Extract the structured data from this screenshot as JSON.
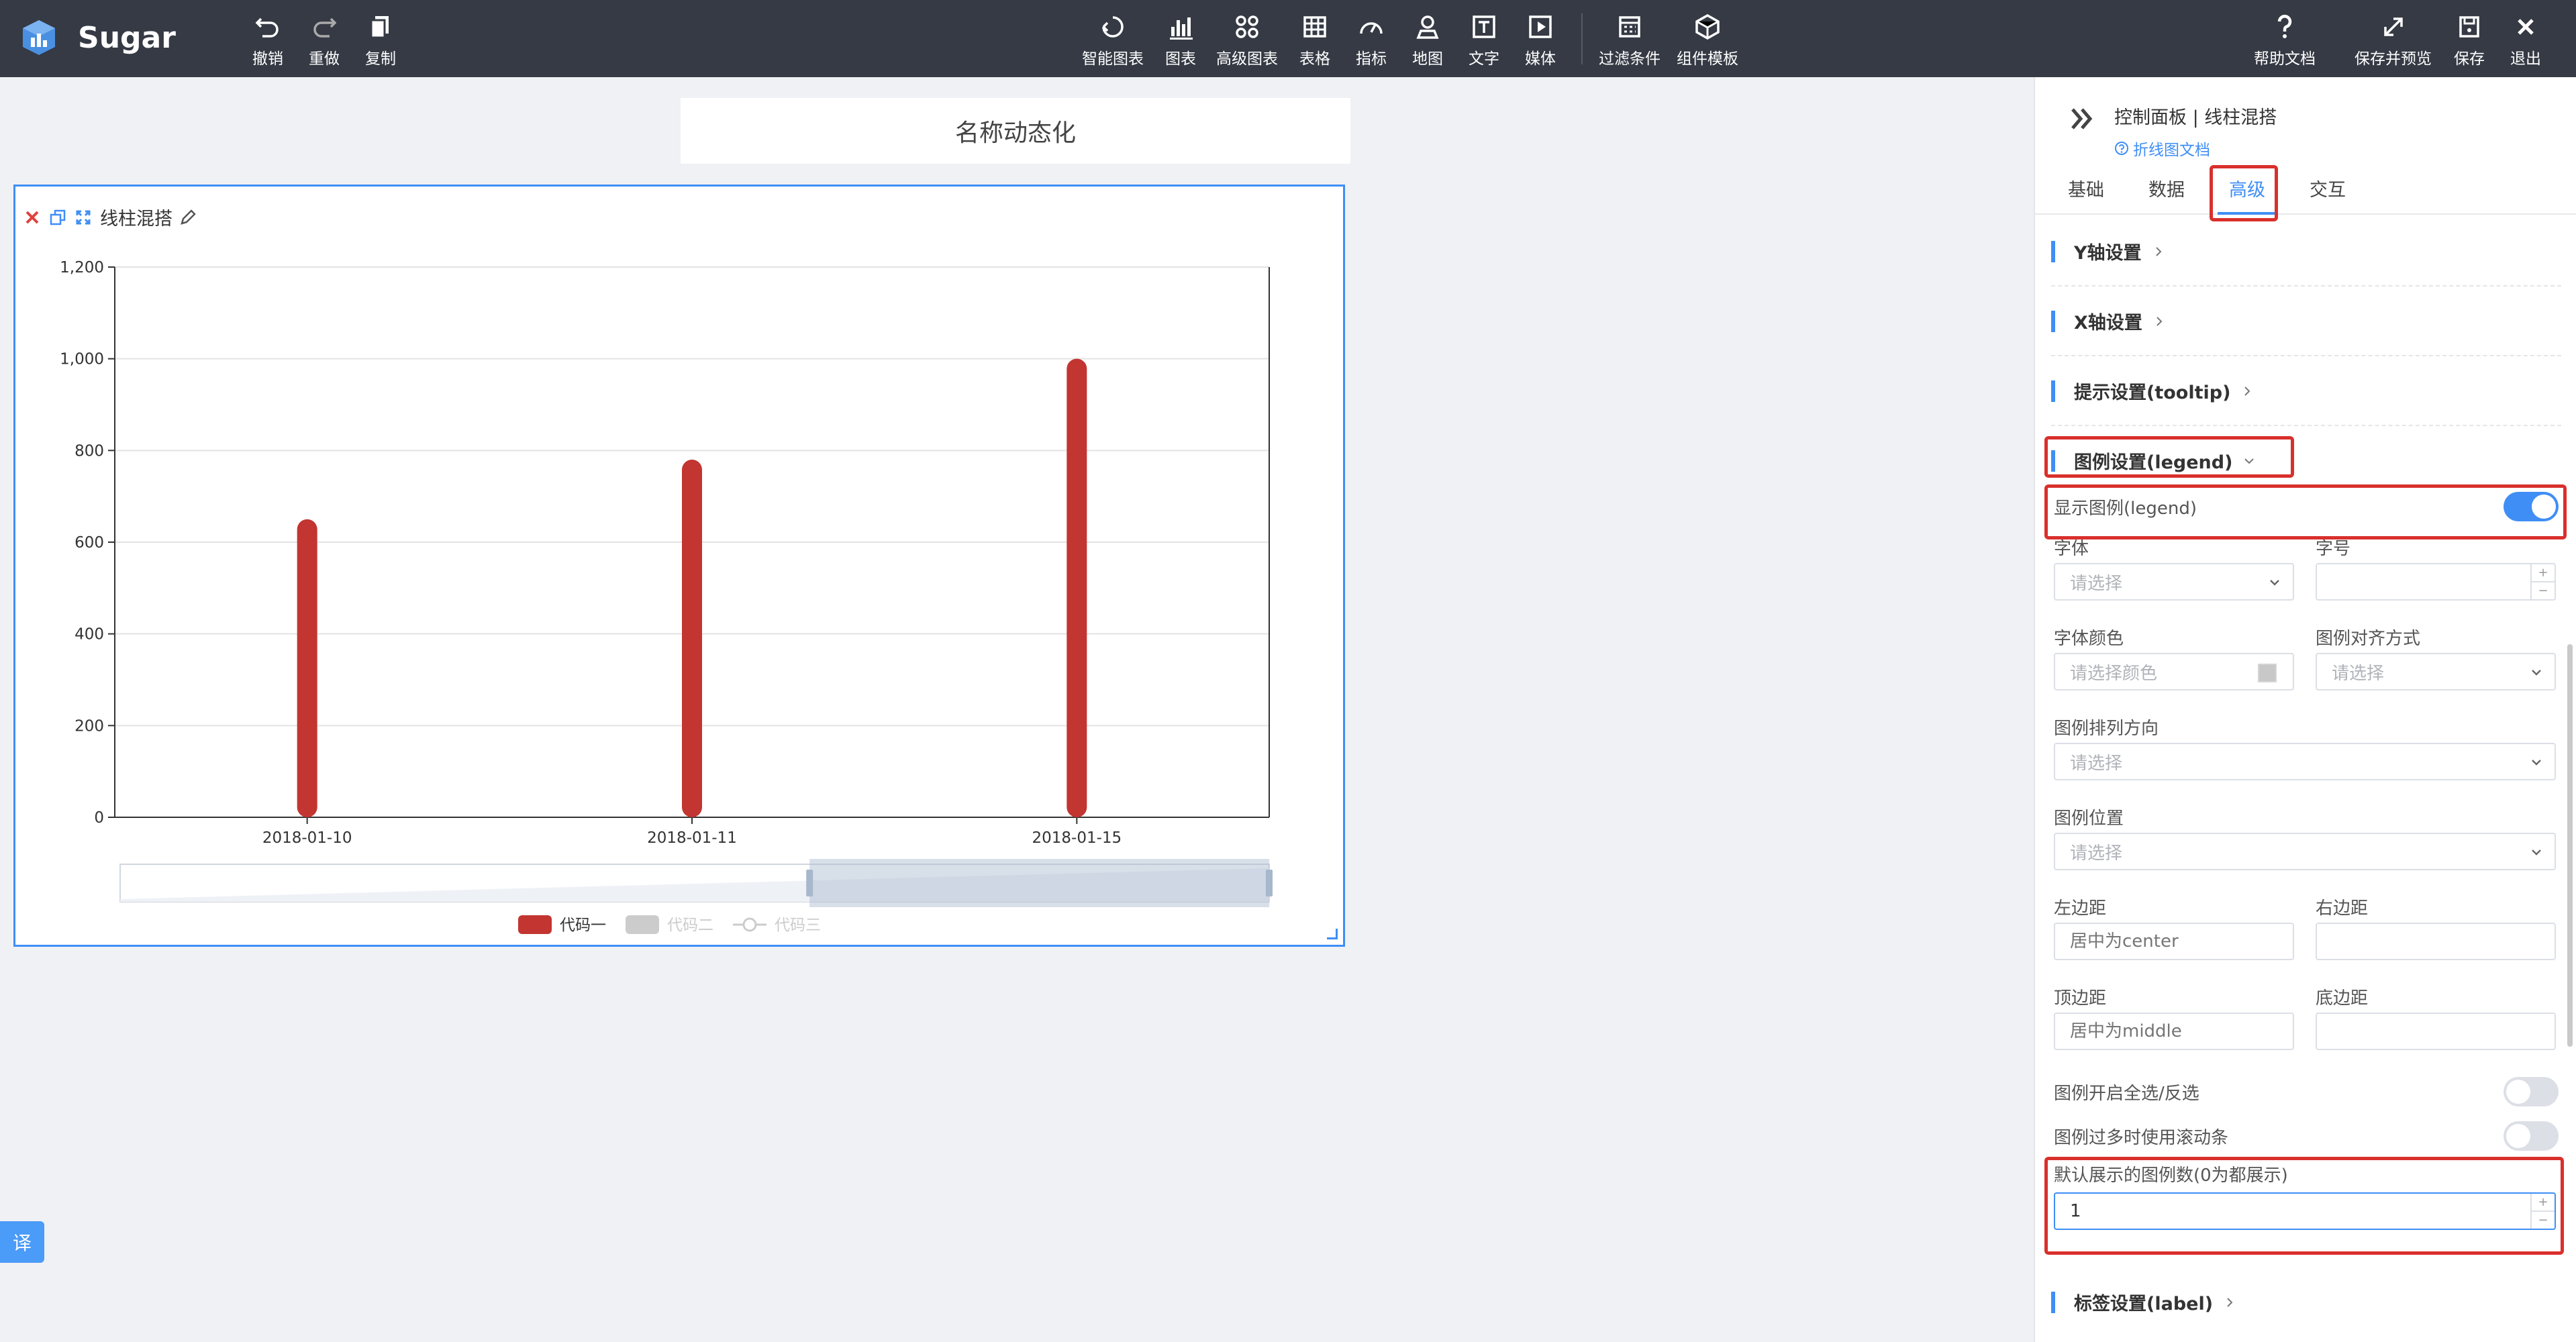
{
  "app": {
    "name": "Sugar"
  },
  "toolbar": {
    "left": [
      {
        "id": "undo",
        "label": "撤销",
        "icon": "undo-icon"
      },
      {
        "id": "redo",
        "label": "重做",
        "icon": "redo-icon"
      },
      {
        "id": "copy",
        "label": "复制",
        "icon": "copy-icon"
      }
    ],
    "center": [
      {
        "id": "smart-chart",
        "label": "智能图表",
        "icon": "smart-chart-icon"
      },
      {
        "id": "chart",
        "label": "图表",
        "icon": "bar-chart-icon"
      },
      {
        "id": "advanced-chart",
        "label": "高级图表",
        "icon": "advanced-chart-icon"
      },
      {
        "id": "table",
        "label": "表格",
        "icon": "table-icon"
      },
      {
        "id": "indicator",
        "label": "指标",
        "icon": "gauge-icon"
      },
      {
        "id": "map",
        "label": "地图",
        "icon": "map-pin-icon"
      },
      {
        "id": "text",
        "label": "文字",
        "icon": "text-icon"
      },
      {
        "id": "media",
        "label": "媒体",
        "icon": "media-icon"
      },
      {
        "id": "filter",
        "label": "过滤条件",
        "icon": "filter-icon"
      },
      {
        "id": "component-template",
        "label": "组件模板",
        "icon": "cube-icon"
      }
    ],
    "right": [
      {
        "id": "help",
        "label": "帮助文档",
        "icon": "help-icon"
      },
      {
        "id": "save-preview",
        "label": "保存并预览",
        "icon": "expand-icon"
      },
      {
        "id": "save",
        "label": "保存",
        "icon": "save-icon"
      },
      {
        "id": "exit",
        "label": "退出",
        "icon": "close-icon"
      }
    ]
  },
  "canvas": {
    "title": "名称动态化",
    "widget": {
      "name": "线柱混搭"
    },
    "fab_label": "译"
  },
  "chart_data": {
    "type": "bar",
    "categories": [
      "2018-01-10",
      "2018-01-11",
      "2018-01-15"
    ],
    "series": [
      {
        "name": "代码一",
        "values": [
          650,
          780,
          1000
        ],
        "color": "#c23531",
        "visible": true,
        "marker": "bar"
      },
      {
        "name": "代码二",
        "values": [],
        "color": "#cccccc",
        "visible": false,
        "marker": "bar"
      },
      {
        "name": "代码三",
        "values": [],
        "color": "#cccccc",
        "visible": false,
        "marker": "line"
      }
    ],
    "yticks": [
      "0",
      "200",
      "400",
      "600",
      "800",
      "1,000",
      "1,200"
    ],
    "ylim": [
      0,
      1200
    ],
    "grid": true,
    "legend_position": "bottom-center",
    "datazoom": {
      "start": 0.6,
      "end": 1.0
    }
  },
  "panel": {
    "breadcrumb": "控制面板 | 线柱混搭",
    "doc_link": "折线图文档",
    "tabs": [
      "基础",
      "数据",
      "高级",
      "交互"
    ],
    "active_tab": "高级",
    "sections": {
      "y_axis": "Y轴设置",
      "x_axis": "X轴设置",
      "tooltip": "提示设置(tooltip)",
      "legend": "图例设置(legend)",
      "label": "标签设置(label)"
    },
    "legend": {
      "show_label": "显示图例(legend)",
      "show": true,
      "font_label": "字体",
      "font_placeholder": "请选择",
      "size_label": "字号",
      "color_label": "字体颜色",
      "color_placeholder": "请选择颜色",
      "align_label": "图例对齐方式",
      "align_placeholder": "请选择",
      "orient_label": "图例排列方向",
      "orient_placeholder": "请选择",
      "position_label": "图例位置",
      "position_placeholder": "请选择",
      "left_label": "左边距",
      "left_placeholder": "居中为center",
      "right_label": "右边距",
      "top_label": "顶边距",
      "top_placeholder": "居中为middle",
      "bottom_label": "底边距",
      "select_all_label": "图例开启全选/反选",
      "select_all": false,
      "scroll_label": "图例过多时使用滚动条",
      "scroll": false,
      "default_count_label": "默认展示的图例数(0为都展示)",
      "default_count_value": "1"
    }
  }
}
